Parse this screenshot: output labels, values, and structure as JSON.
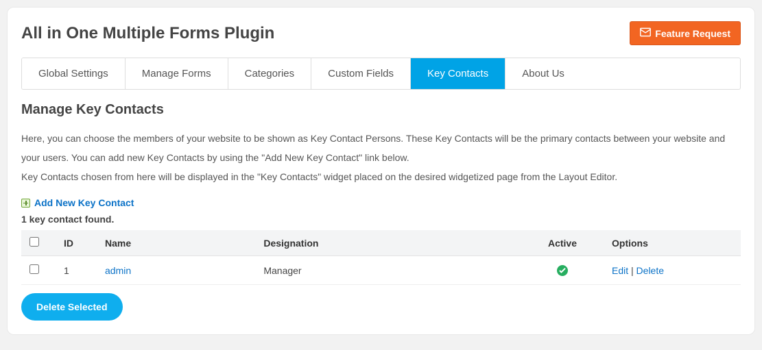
{
  "header": {
    "title": "All in One Multiple Forms Plugin",
    "feature_button": "Feature Request"
  },
  "tabs": [
    {
      "label": "Global Settings",
      "active": false
    },
    {
      "label": "Manage Forms",
      "active": false
    },
    {
      "label": "Categories",
      "active": false
    },
    {
      "label": "Custom Fields",
      "active": false
    },
    {
      "label": "Key Contacts",
      "active": true
    },
    {
      "label": "About Us",
      "active": false
    }
  ],
  "section": {
    "title": "Manage Key Contacts",
    "desc1": "Here, you can choose the members of your website to be shown as Key Contact Persons. These Key Contacts will be the primary contacts between your website and your users. You can add new Key Contacts by using the \"Add New Key Contact\" link below.",
    "desc2": "Key Contacts chosen from here will be displayed in the \"Key Contacts\" widget placed on the desired widgetized page from the Layout Editor.",
    "add_link": "Add New Key Contact",
    "count_text": "1 key contact found."
  },
  "table": {
    "headers": {
      "id": "ID",
      "name": "Name",
      "designation": "Designation",
      "active": "Active",
      "options": "Options"
    },
    "rows": [
      {
        "id": "1",
        "name": "admin",
        "designation": "Manager",
        "active": true,
        "edit": "Edit",
        "delete": "Delete",
        "separator": " | "
      }
    ]
  },
  "actions": {
    "delete_selected": "Delete Selected"
  }
}
